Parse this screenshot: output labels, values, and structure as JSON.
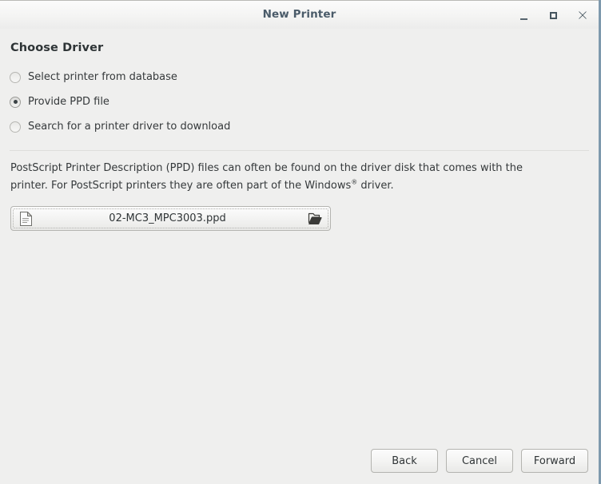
{
  "window": {
    "title": "New Printer",
    "controls": [
      {
        "name": "minimize",
        "glyph": "_"
      },
      {
        "name": "maximize",
        "glyph": "□"
      },
      {
        "name": "close",
        "glyph": "✕"
      }
    ]
  },
  "page": {
    "heading": "Choose Driver"
  },
  "driver_options": [
    {
      "label": "Select printer from database",
      "selected": false
    },
    {
      "label": "Provide PPD file",
      "selected": true
    },
    {
      "label": "Search for a printer driver to download",
      "selected": false
    }
  ],
  "description": {
    "part1": "PostScript Printer Description (PPD) files can often be found on the driver disk that comes with the printer. For PostScript printers they are often part of the Windows",
    "trademark": "®",
    "part2": " driver."
  },
  "file_chooser": {
    "filename": "02-MC3_MPC3003.ppd",
    "doc_icon": "document-icon",
    "open_icon": "open-folder-icon"
  },
  "actions": {
    "back": "Back",
    "cancel": "Cancel",
    "forward": "Forward"
  },
  "colors": {
    "window_background": "#efefee",
    "titlebar_top": "#fbfbfb",
    "title_text": "#4a5b69",
    "body_text": "#35393b",
    "border": "#b4b4b0",
    "window_edge": "#7e99ad"
  }
}
